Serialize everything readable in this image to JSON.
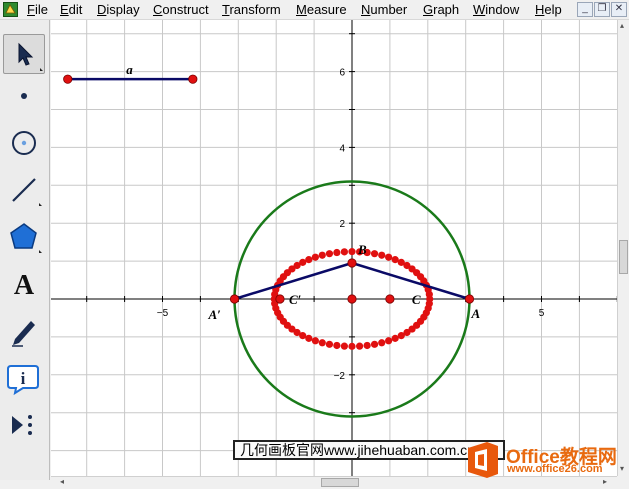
{
  "menu": {
    "items": [
      {
        "label": "File",
        "access": "F"
      },
      {
        "label": "Edit",
        "access": "E"
      },
      {
        "label": "Display",
        "access": "D"
      },
      {
        "label": "Construct",
        "access": "C"
      },
      {
        "label": "Transform",
        "access": "T"
      },
      {
        "label": "Measure",
        "access": "M"
      },
      {
        "label": "Number",
        "access": "N"
      },
      {
        "label": "Graph",
        "access": "G"
      },
      {
        "label": "Window",
        "access": "W"
      },
      {
        "label": "Help",
        "access": "H"
      }
    ]
  },
  "window_controls": {
    "minimize": "_",
    "restore": "❐",
    "close": "✕"
  },
  "toolbox": {
    "tools": [
      {
        "name": "arrow-tool",
        "icon": "arrow-select-icon",
        "active": true
      },
      {
        "name": "point-tool",
        "icon": "point-icon"
      },
      {
        "name": "compass-tool",
        "icon": "compass-circle-icon"
      },
      {
        "name": "straightedge-tool",
        "icon": "segment-icon"
      },
      {
        "name": "polygon-tool",
        "icon": "polygon-icon"
      },
      {
        "name": "text-tool",
        "icon": "text-A-icon",
        "glyph": "A"
      },
      {
        "name": "marker-tool",
        "icon": "marker-pen-icon"
      },
      {
        "name": "information-tool",
        "icon": "info-icon",
        "glyph": "i"
      },
      {
        "name": "custom-tool",
        "icon": "custom-tools-icon"
      }
    ]
  },
  "sketch": {
    "x_tick_labels": [
      "−5",
      "5"
    ],
    "y_tick_labels": [
      "6",
      "4",
      "2",
      "−2"
    ],
    "parameter_label": "a",
    "point_labels": {
      "B": "B",
      "A": "A",
      "A_prime": "A′",
      "C": "C",
      "C_prime": "C′"
    },
    "colors": {
      "grid": "#c8c8c8",
      "axis": "#000000",
      "circle": "#1a7a1a",
      "segments": "#0a0a66",
      "points": "#e01010",
      "ellipse_trace": "#e01010"
    },
    "parameter_segment": {
      "start": [
        -7.5,
        5.8
      ],
      "end": [
        -4.2,
        5.8
      ]
    },
    "points": {
      "A": [
        3.1,
        0
      ],
      "A_prime": [
        -3.1,
        0
      ],
      "B": [
        0,
        0.95
      ],
      "origin": [
        0,
        0
      ],
      "C": [
        1.0,
        0
      ],
      "C_prime_hidden": [
        -1.9,
        0
      ]
    },
    "circle": {
      "center": [
        0,
        0
      ],
      "radius": 3.1
    },
    "ellipse": {
      "center": [
        0,
        0
      ],
      "rx": 2.05,
      "ry": 1.25
    }
  },
  "watermark": {
    "caption": "几何画板官网www.jihehuaban.com.cn",
    "brand": "Office教程网",
    "url": "www.office26.com"
  },
  "scroll": {
    "left_arrow": "◂",
    "right_arrow": "▸",
    "up_arrow": "▴",
    "down_arrow": "▾"
  }
}
